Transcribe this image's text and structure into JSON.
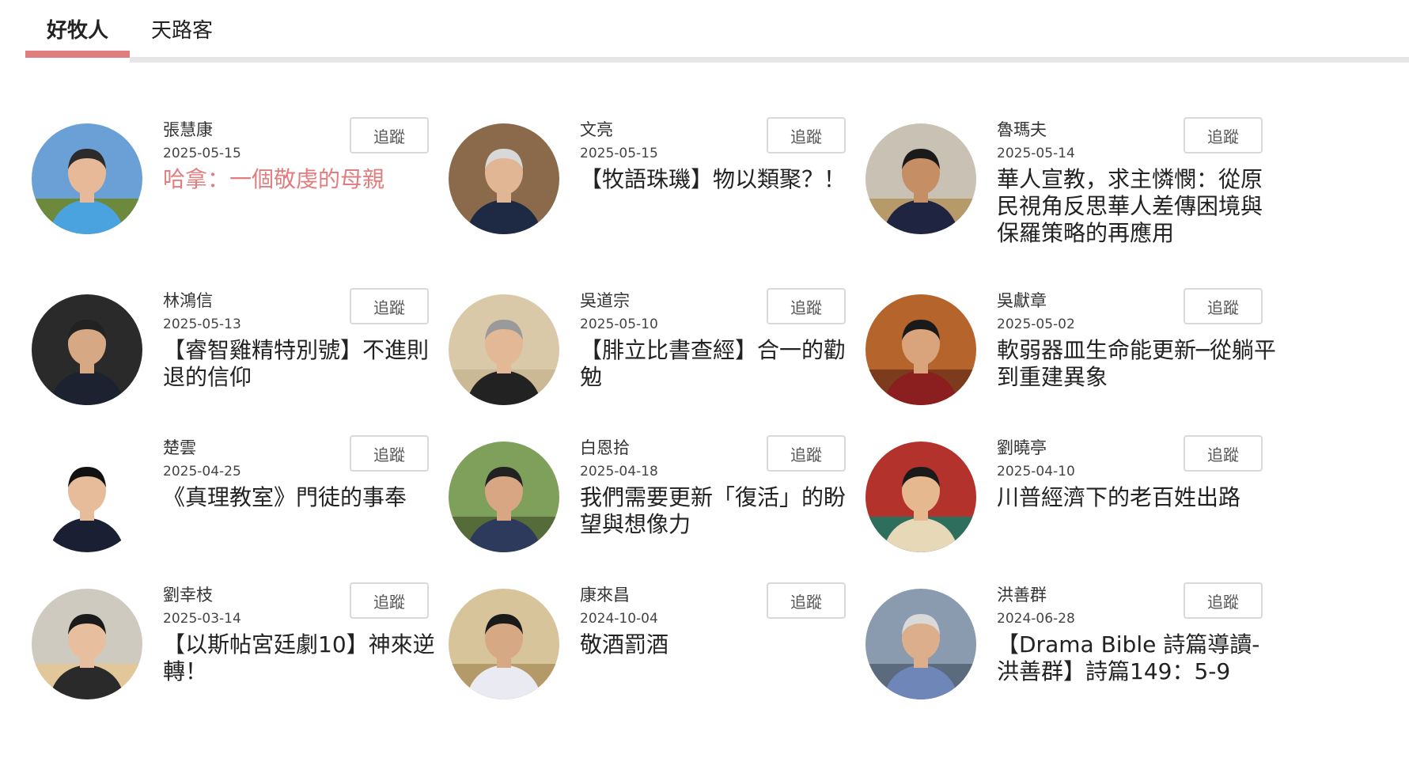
{
  "tabs": [
    {
      "label": "好牧人",
      "active": true
    },
    {
      "label": "天路客",
      "active": false
    }
  ],
  "accent_color": "#e27d7f",
  "follow_label": "追蹤",
  "articles": [
    {
      "author": "張慧康",
      "date": "2025-05-15",
      "title": "哈拿：一個敬虔的母親",
      "highlight": true,
      "avatar": {
        "bg": "#6aa0d6",
        "ground": "#6d8a3c",
        "skin": "#e8b999",
        "shirt": "#4aa3df",
        "hair": "#2b2b2b"
      }
    },
    {
      "author": "文亮",
      "date": "2025-05-15",
      "title": "【牧語珠璣】物以類聚？！",
      "highlight": false,
      "avatar": {
        "bg": "#8a6a4a",
        "ground": "#8a6a4a",
        "skin": "#e0b694",
        "shirt": "#1e2a44",
        "hair": "#d8d8d8"
      }
    },
    {
      "author": "魯瑪夫",
      "date": "2025-05-14",
      "title": "華人宣教，求主憐憫：從原民視角反思華人差傳困境與保羅策略的再應用",
      "highlight": false,
      "avatar": {
        "bg": "#c9c2b4",
        "ground": "#b79a6a",
        "skin": "#c68e64",
        "shirt": "#1f2540",
        "hair": "#1a1a1a"
      }
    },
    {
      "author": "林鴻信",
      "date": "2025-05-13",
      "title": "【睿智雞精特別號】不進則退的信仰",
      "highlight": false,
      "avatar": {
        "bg": "#2a2a2a",
        "ground": "#2a2a2a",
        "skin": "#d6a883",
        "shirt": "#1c2230",
        "hair": "#222"
      }
    },
    {
      "author": "吳道宗",
      "date": "2025-05-10",
      "title": "【腓立比書查經】合一的勸勉",
      "highlight": false,
      "avatar": {
        "bg": "#d9c9a8",
        "ground": "#cbb894",
        "skin": "#e2b897",
        "shirt": "#222222",
        "hair": "#9a9a9a"
      }
    },
    {
      "author": "吳獻章",
      "date": "2025-05-02",
      "title": "軟弱器皿生命能更新─從躺平到重建異象",
      "highlight": false,
      "avatar": {
        "bg": "#b5652c",
        "ground": "#7b3b1c",
        "skin": "#d9a37b",
        "shirt": "#8b1e1e",
        "hair": "#1a1a1a"
      }
    },
    {
      "author": "楚雲",
      "date": "2025-04-25",
      "title": "《真理教室》門徒的事奉",
      "highlight": false,
      "avatar": {
        "bg": "#ffffff",
        "ground": "#ffffff",
        "skin": "#e6bc9a",
        "shirt": "#1a1f33",
        "hair": "#111111"
      }
    },
    {
      "author": "白恩拾",
      "date": "2025-04-18",
      "title": "我們需要更新「復活」的盼望與想像力",
      "highlight": false,
      "avatar": {
        "bg": "#7fa05a",
        "ground": "#566b3a",
        "skin": "#d8a682",
        "shirt": "#2e3a5c",
        "hair": "#222"
      }
    },
    {
      "author": "劉曉亭",
      "date": "2025-04-10",
      "title": "川普經濟下的老百姓出路",
      "highlight": false,
      "avatar": {
        "bg": "#b4322c",
        "ground": "#2d6e5c",
        "skin": "#e5b890",
        "shirt": "#e7d8b8",
        "hair": "#1a1a1a"
      }
    },
    {
      "author": "劉幸枝",
      "date": "2025-03-14",
      "title": "【以斯帖宮廷劇10】神來逆轉！",
      "highlight": false,
      "avatar": {
        "bg": "#cfcabf",
        "ground": "#e2c79a",
        "skin": "#e8bf9e",
        "shirt": "#2a2a2a",
        "hair": "#1a1a1a"
      }
    },
    {
      "author": "康來昌",
      "date": "2024-10-04",
      "title": "敬酒罰酒",
      "highlight": false,
      "avatar": {
        "bg": "#d8c49a",
        "ground": "#b49a68",
        "skin": "#d7a884",
        "shirt": "#e9eaf2",
        "hair": "#1a1a1a"
      }
    },
    {
      "author": "洪善群",
      "date": "2024-06-28",
      "title": "【Drama Bible 詩篇導讀-洪善群】詩篇149：5-9",
      "highlight": false,
      "avatar": {
        "bg": "#8a9bb0",
        "ground": "#5b6a7c",
        "skin": "#dcae8b",
        "shirt": "#6f86b8",
        "hair": "#d9d9d9"
      }
    }
  ]
}
